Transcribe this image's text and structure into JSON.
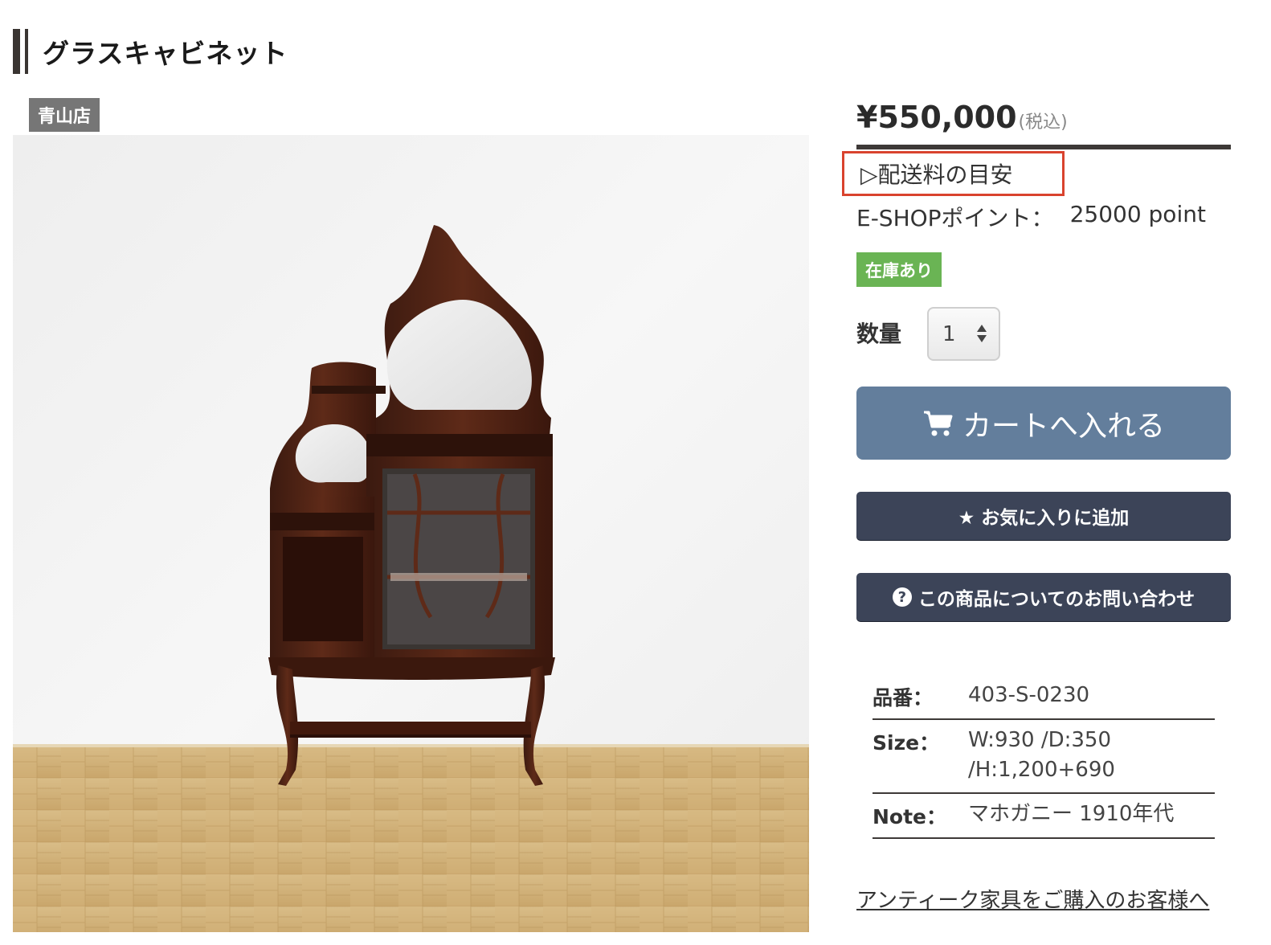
{
  "product": {
    "title": "グラスキャビネット",
    "store_badge": "青山店",
    "photo_icon": "glass-cabinet-photo"
  },
  "purchase": {
    "price": "¥550,000",
    "price_tax_note": "(税込)",
    "shipping_link": "▷配送料の目安",
    "points_label": "E-SHOPポイント：",
    "points_value": "25000 point",
    "stock_status": "在庫あり",
    "stock_color": "#6ab454",
    "quantity_label": "数量",
    "quantity_value": "1",
    "cart_button": "カートへ入れる",
    "cart_button_color": "#637e9c",
    "favorite_button": "★ お気に入りに追加",
    "inquiry_button": "この商品についてのお問い合わせ",
    "inquiry_icon": "question-circle-icon",
    "dark_button_color": "#3c4458"
  },
  "specs": {
    "rows": [
      {
        "key": "品番：",
        "value_lines": [
          "403-S-0230"
        ]
      },
      {
        "key": "Size：",
        "value_lines": [
          "W:930 /D:350",
          "/H:1,200+690"
        ]
      },
      {
        "key": "Note：",
        "value_lines": [
          "マホガニー 1910年代"
        ]
      }
    ]
  },
  "footer": {
    "link": "アンティーク家具をご購入のお客様へ"
  },
  "highlight": {
    "color": "#d9432e"
  }
}
